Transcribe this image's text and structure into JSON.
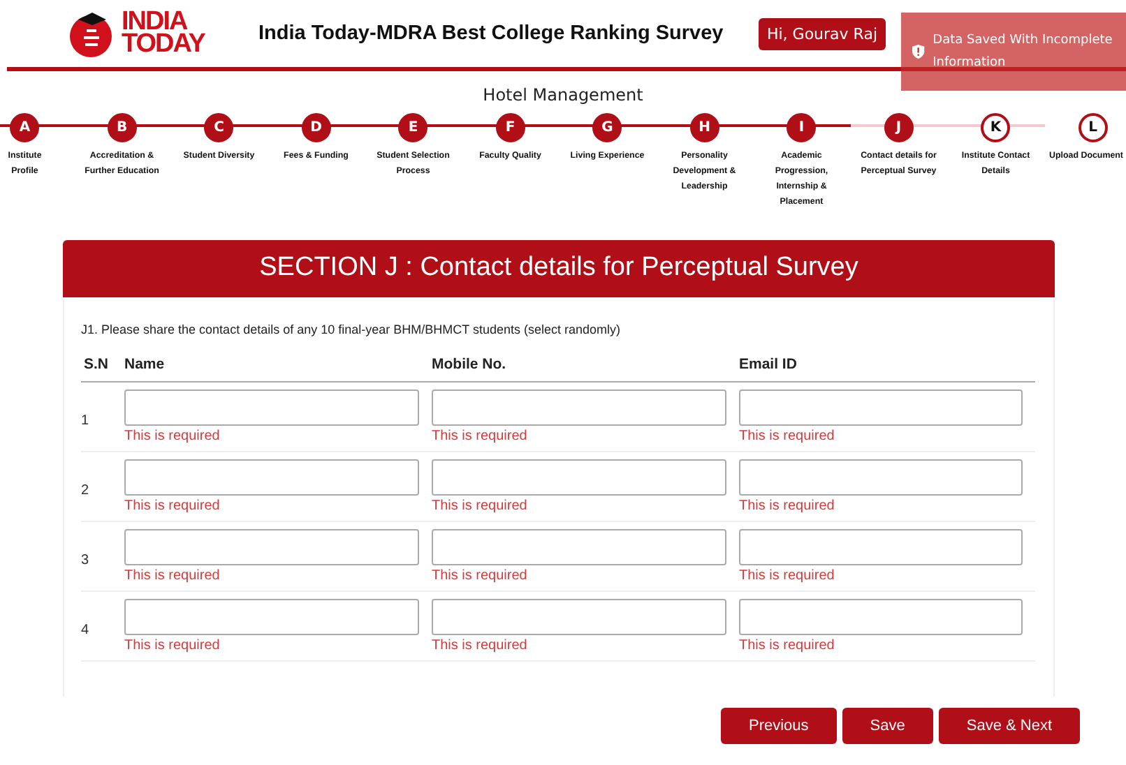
{
  "header": {
    "logo": {
      "line_1": "INDIA",
      "line_2": "TODAY"
    },
    "title": "India Today-MDRA Best College Ranking Survey",
    "user_button": "Hi, Gourav Raj"
  },
  "toast": {
    "message": "Data Saved With Incomplete Information"
  },
  "discipline": "Hotel Management",
  "steps": [
    {
      "letter": "A",
      "label": "Institute Profile",
      "done": true
    },
    {
      "letter": "B",
      "label": "Accreditation & Further Education",
      "done": true
    },
    {
      "letter": "C",
      "label": "Student Diversity",
      "done": true
    },
    {
      "letter": "D",
      "label": "Fees & Funding",
      "done": true
    },
    {
      "letter": "E",
      "label": "Student Selection Process",
      "done": true
    },
    {
      "letter": "F",
      "label": "Faculty Quality",
      "done": true
    },
    {
      "letter": "G",
      "label": "Living Experience",
      "done": true
    },
    {
      "letter": "H",
      "label": "Personality Development & Leadership",
      "done": true
    },
    {
      "letter": "I",
      "label": "Academic Progression, Internship & Placement",
      "done": true
    },
    {
      "letter": "J",
      "label": "Contact details for Perceptual Survey",
      "done": true
    },
    {
      "letter": "K",
      "label": "Institute Contact Details",
      "done": false
    },
    {
      "letter": "L",
      "label": "Upload Document",
      "done": false
    }
  ],
  "section": {
    "title": "SECTION J : Contact details for Perceptual Survey",
    "question": "J1. Please share the contact details of any 10 final-year BHM/BHMCT students (select randomly)",
    "columns": [
      "S.N",
      "Name",
      "Mobile No.",
      "Email ID"
    ],
    "rows": [
      {
        "sn": "1",
        "errors": [
          "This is required",
          "This is required",
          "This is required"
        ]
      },
      {
        "sn": "2",
        "errors": [
          "This is required",
          "This is required",
          "This is required"
        ]
      },
      {
        "sn": "3",
        "errors": [
          "This is required",
          "This is required",
          "This is required"
        ]
      },
      {
        "sn": "4",
        "errors": [
          "This is required",
          "This is required",
          "This is required"
        ]
      }
    ]
  },
  "buttons": [
    "Previous",
    "Save",
    "Save & Next"
  ]
}
